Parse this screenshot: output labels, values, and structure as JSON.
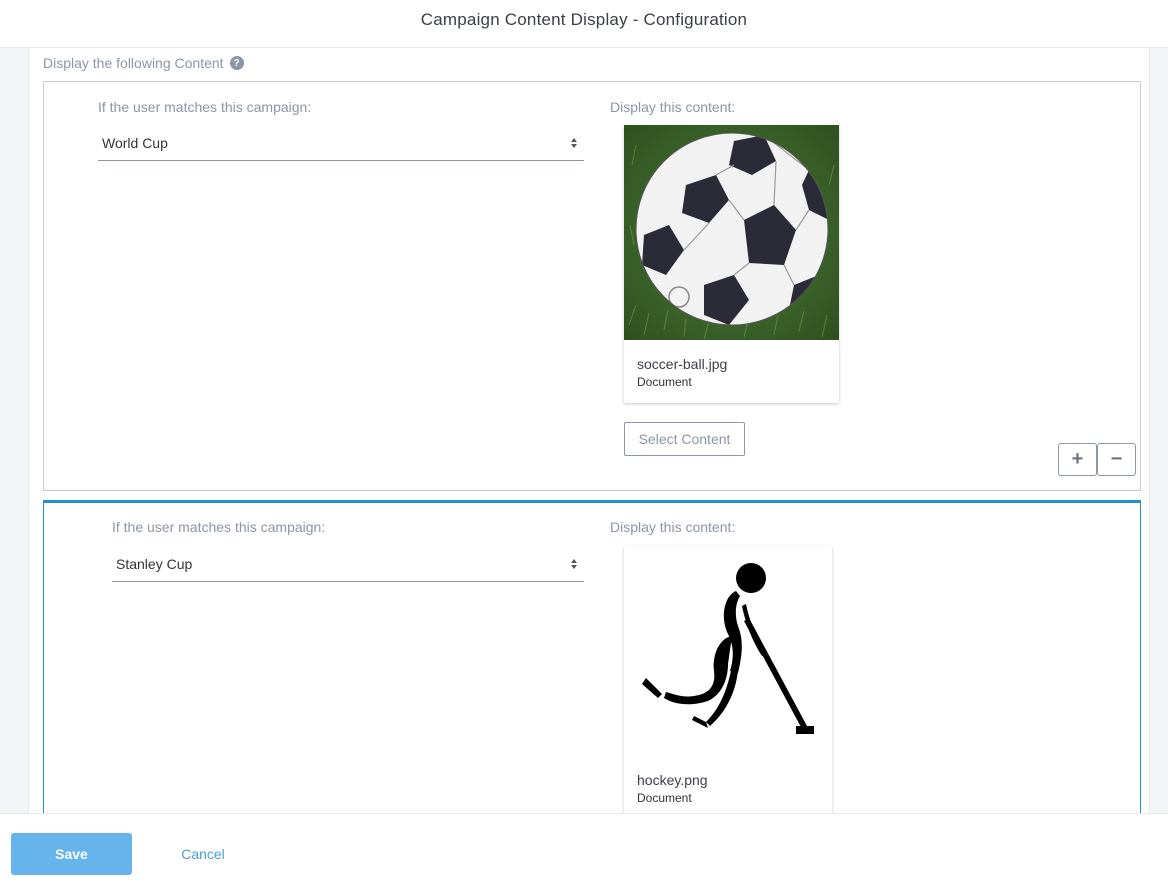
{
  "header": {
    "title": "Campaign Content Display - Configuration"
  },
  "section": {
    "label": "Display the following Content",
    "help_icon": "question-circle-icon"
  },
  "rules": [
    {
      "campaign_label": "If the user matches this campaign:",
      "campaign_value": "World Cup",
      "content_label": "Display this content:",
      "content": {
        "file_name": "soccer-ball.jpg",
        "file_type": "Document",
        "thumbnail": "soccer-ball-image"
      },
      "select_content_label": "Select Content",
      "add_label": "+",
      "remove_label": "−"
    },
    {
      "campaign_label": "If the user matches this campaign:",
      "campaign_value": "Stanley Cup",
      "content_label": "Display this content:",
      "content": {
        "file_name": "hockey.png",
        "file_type": "Document",
        "thumbnail": "hockey-player-image"
      }
    }
  ],
  "footer": {
    "save_label": "Save",
    "cancel_label": "Cancel"
  },
  "colors": {
    "accent": "#2391d0",
    "save_button": "#65b4ec",
    "cancel_link": "#4a9fd9",
    "muted_text": "#8c96a4"
  }
}
